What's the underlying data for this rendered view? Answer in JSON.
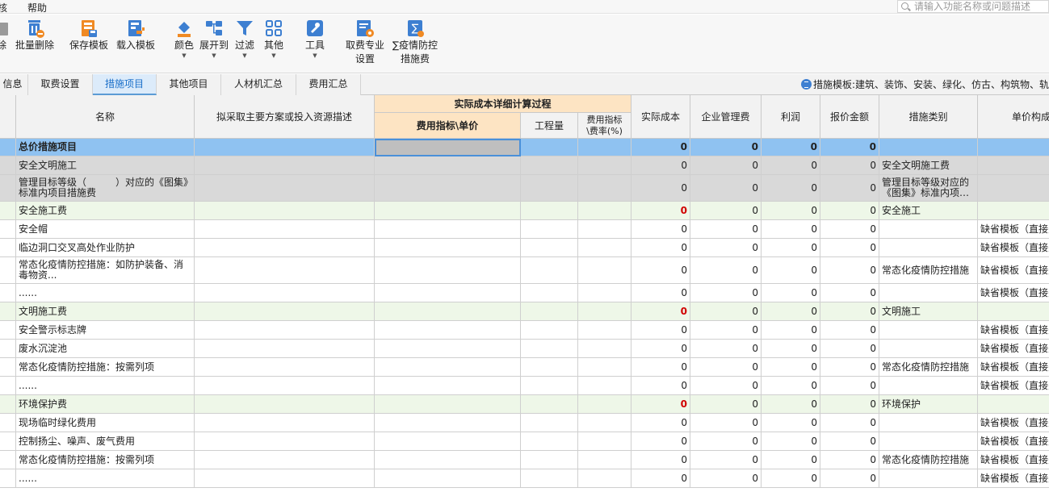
{
  "menu": {
    "left_cut": "核",
    "help": "帮助"
  },
  "search": {
    "placeholder": "请输入功能名称或问题描述"
  },
  "toolbar": {
    "cut_label": "除",
    "batch_delete": "批量删除",
    "save_template": "保存模板",
    "load_template": "载入模板",
    "color": "颜色",
    "expand_to": "展开到",
    "filter": "过滤",
    "other": "其他",
    "tools": "工具",
    "fee_setting_line1": "取费专业",
    "fee_setting_line2": "设置",
    "epidemic_line1": "∑疫情防控",
    "epidemic_line2": "措施费",
    "accent": "#3d7fd1",
    "orange": "#f08a24"
  },
  "tabs": [
    "信息",
    "取费设置",
    "措施项目",
    "其他项目",
    "人材机汇总",
    "费用汇总"
  ],
  "active_tab": "措施项目",
  "template_info": "措施模板:建筑、装饰、安装、绿化、仿古、构筑物、轨",
  "headers": {
    "name": "名称",
    "plan": "拟采取主要方案或投入资源描述",
    "group": "实际成本详细计算过程",
    "unit_price": "费用指标\\单价",
    "quantity": "工程量",
    "rate": "费用指标\\费率(%)",
    "actual_cost": "实际成本",
    "mgmt_fee": "企业管理费",
    "profit": "利润",
    "quote": "报价金额",
    "category": "措施类别",
    "unit_comp": "单价构成"
  },
  "rows": [
    {
      "type": "total",
      "name": "总价措施项目",
      "actual": "0",
      "mgmt": "0",
      "profit": "0",
      "quote": "0",
      "category": "",
      "comp": ""
    },
    {
      "type": "cat",
      "name": "安全文明施工",
      "actual": "0",
      "mgmt": "0",
      "profit": "0",
      "quote": "0",
      "category": "安全文明施工费",
      "comp": ""
    },
    {
      "type": "cat",
      "name": "管理目标等级（　　　）对应的《图集》标准内项目措施费",
      "actual": "0",
      "mgmt": "0",
      "profit": "0",
      "quote": "0",
      "category": "管理目标等级对应的《图集》标准内项…",
      "comp": ""
    },
    {
      "type": "sub",
      "name": "安全施工费",
      "actual": "0",
      "mgmt": "0",
      "profit": "0",
      "quote": "0",
      "category": "安全施工",
      "comp": ""
    },
    {
      "type": "item",
      "name": "安全帽",
      "actual": "0",
      "mgmt": "0",
      "profit": "0",
      "quote": "0",
      "category": "",
      "comp": "缺省模板（直接费"
    },
    {
      "type": "item",
      "name": "临边洞口交叉高处作业防护",
      "actual": "0",
      "mgmt": "0",
      "profit": "0",
      "quote": "0",
      "category": "",
      "comp": "缺省模板（直接费"
    },
    {
      "type": "item",
      "name": "常态化疫情防控措施：如防护装备、消毒物资...",
      "actual": "0",
      "mgmt": "0",
      "profit": "0",
      "quote": "0",
      "category": "常态化疫情防控措施",
      "comp": "缺省模板（直接费"
    },
    {
      "type": "item",
      "name": "......",
      "actual": "0",
      "mgmt": "0",
      "profit": "0",
      "quote": "0",
      "category": "",
      "comp": "缺省模板（直接费"
    },
    {
      "type": "sub",
      "name": "文明施工费",
      "actual": "0",
      "mgmt": "0",
      "profit": "0",
      "quote": "0",
      "category": "文明施工",
      "comp": ""
    },
    {
      "type": "item",
      "name": "安全警示标志牌",
      "actual": "0",
      "mgmt": "0",
      "profit": "0",
      "quote": "0",
      "category": "",
      "comp": "缺省模板（直接费"
    },
    {
      "type": "item",
      "name": "废水沉淀池",
      "actual": "0",
      "mgmt": "0",
      "profit": "0",
      "quote": "0",
      "category": "",
      "comp": "缺省模板（直接费"
    },
    {
      "type": "item",
      "name": "常态化疫情防控措施：按需列项",
      "actual": "0",
      "mgmt": "0",
      "profit": "0",
      "quote": "0",
      "category": "常态化疫情防控措施",
      "comp": "缺省模板（直接费"
    },
    {
      "type": "item",
      "name": "......",
      "actual": "0",
      "mgmt": "0",
      "profit": "0",
      "quote": "0",
      "category": "",
      "comp": "缺省模板（直接费"
    },
    {
      "type": "sub",
      "name": "环境保护费",
      "actual": "0",
      "mgmt": "0",
      "profit": "0",
      "quote": "0",
      "category": "环境保护",
      "comp": ""
    },
    {
      "type": "item",
      "name": "现场临时绿化费用",
      "actual": "0",
      "mgmt": "0",
      "profit": "0",
      "quote": "0",
      "category": "",
      "comp": "缺省模板（直接费"
    },
    {
      "type": "item",
      "name": "控制扬尘、噪声、废气费用",
      "actual": "0",
      "mgmt": "0",
      "profit": "0",
      "quote": "0",
      "category": "",
      "comp": "缺省模板（直接费"
    },
    {
      "type": "item",
      "name": "常态化疫情防控措施：按需列项",
      "actual": "0",
      "mgmt": "0",
      "profit": "0",
      "quote": "0",
      "category": "常态化疫情防控措施",
      "comp": "缺省模板（直接费"
    },
    {
      "type": "item",
      "name": "......",
      "actual": "0",
      "mgmt": "0",
      "profit": "0",
      "quote": "0",
      "category": "",
      "comp": "缺省模板（直接费"
    }
  ]
}
